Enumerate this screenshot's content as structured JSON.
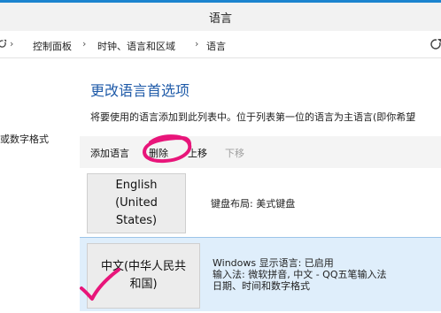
{
  "window": {
    "title": "语言"
  },
  "breadcrumb": {
    "items": [
      "控制面板",
      "时钟、语言和区域",
      "语言"
    ],
    "separator": "›"
  },
  "sidebar": {
    "fragment": "或数字格式"
  },
  "main": {
    "heading": "更改语言首选项",
    "description": "将要使用的语言添加到此列表中。位于列表第一位的语言为主语言(即你希望"
  },
  "toolbar": {
    "add_label": "添加语言",
    "delete_label": "删除",
    "move_up_label": "上移",
    "move_down_label": "下移"
  },
  "languages": [
    {
      "tile_line1": "English (United",
      "tile_line2": "States)",
      "info_lines": [
        "键盘布局: 美式键盘"
      ],
      "selected": false
    },
    {
      "tile_line1": "中文(中华人民共",
      "tile_line2": "和国)",
      "info_lines": [
        "Windows 显示语言: 已启用",
        "输入法: 微软拼音, 中文 - QQ五笔输入法",
        "日期、时间和数字格式"
      ],
      "selected": true
    }
  ],
  "colors": {
    "title_accent": "#1c84cf",
    "heading": "#1e5aa8",
    "selected_row": "#dfeefb",
    "annotation": "#e8157a",
    "disabled_text": "#a0a0a0"
  },
  "icons": {
    "breadcrumb_left": "refresh-icon",
    "address_right": "refresh-icon",
    "annotation_circle": "hand-drawn-circle",
    "annotation_check": "hand-drawn-check"
  }
}
